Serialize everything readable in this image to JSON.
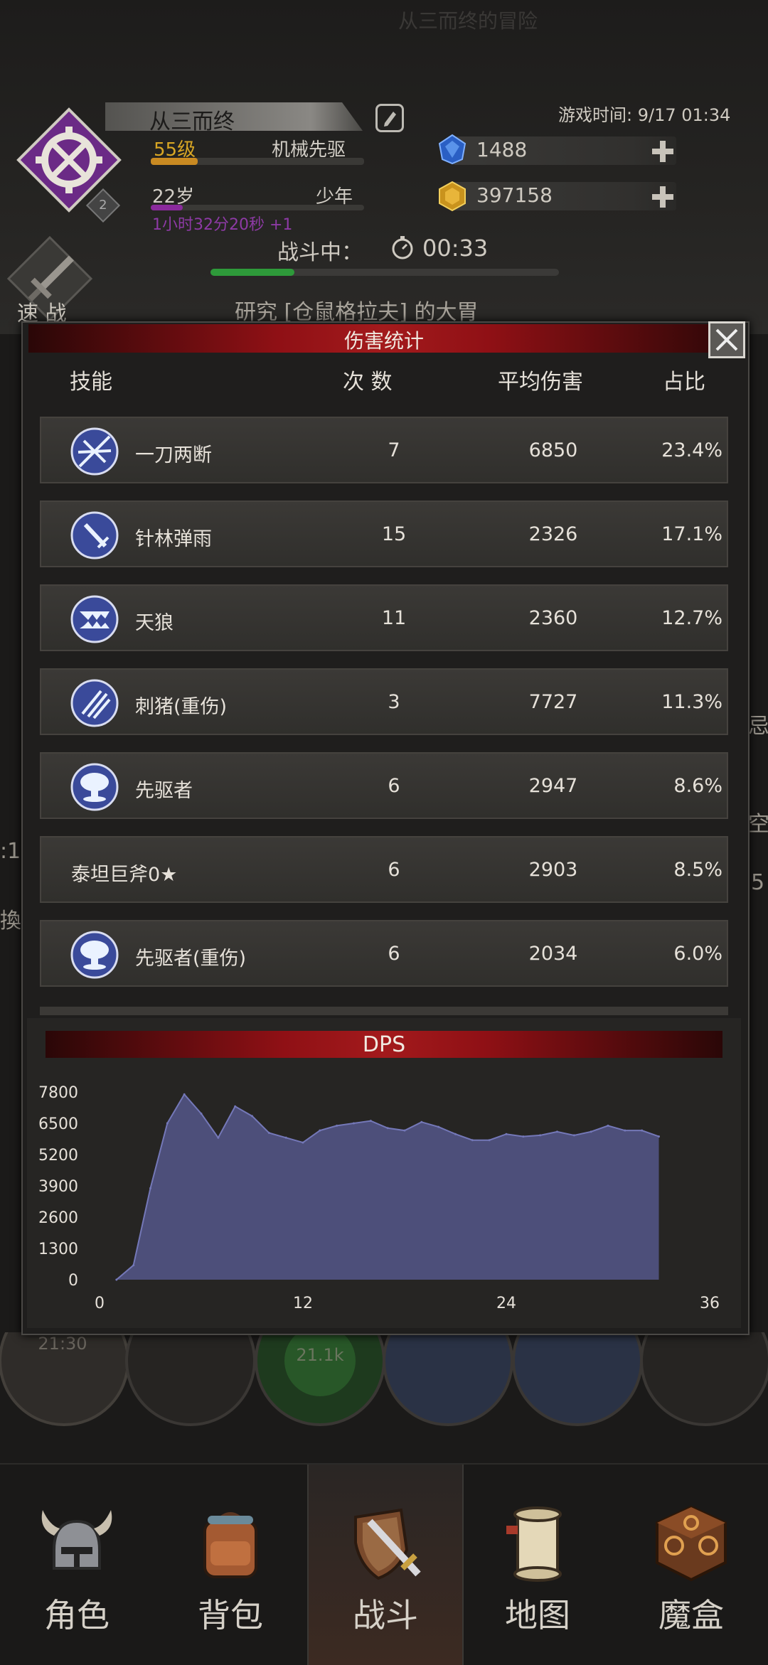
{
  "header": {
    "faded_top": "从三而终的冒险",
    "player_name": "从三而终",
    "level_badge": "2",
    "level_text": "55级",
    "class_text": "机械先驱",
    "level_progress": 0.22,
    "age_text": "22岁",
    "stage_text": "少年",
    "age_progress": 0.15,
    "age_timer": "1小时32分20秒 +1",
    "game_time": "游戏时间: 9/17 01:34",
    "gems": "1488",
    "gold": "397158",
    "battle_label": "战斗中：",
    "battle_time": "00:33",
    "battle_progress": 0.24,
    "quick_label": "速 战",
    "research_text": "研究 [仓鼠格拉夫] 的大胃"
  },
  "background_fragments": {
    "right_a": "忌",
    "right_b": "空",
    "right_c": "5",
    "left_a": ":1",
    "left_b": "換"
  },
  "panel": {
    "title": "伤害统计",
    "columns": {
      "skill": "技能",
      "count": "次 数",
      "avg": "平均伤害",
      "ratio": "占比"
    },
    "rows": [
      {
        "name": "一刀两断",
        "count": "7",
        "avg": "6850",
        "ratio": "23.4%",
        "icon": "slash-burst-icon"
      },
      {
        "name": "针林弹雨",
        "count": "15",
        "avg": "2326",
        "ratio": "17.1%",
        "icon": "sword-icon"
      },
      {
        "name": "天狼",
        "count": "11",
        "avg": "2360",
        "ratio": "12.7%",
        "icon": "fangs-icon"
      },
      {
        "name": "刺猪(重伤)",
        "count": "3",
        "avg": "7727",
        "ratio": "11.3%",
        "icon": "claw-scratch-icon"
      },
      {
        "name": "先驱者",
        "count": "6",
        "avg": "2947",
        "ratio": "8.6%",
        "icon": "mushroom-cloud-icon"
      },
      {
        "name": "泰坦巨斧0★",
        "count": "6",
        "avg": "2903",
        "ratio": "8.5%",
        "icon": ""
      },
      {
        "name": "先驱者(重伤)",
        "count": "6",
        "avg": "2034",
        "ratio": "6.0%",
        "icon": "mushroom-cloud-icon"
      }
    ]
  },
  "chart_data": {
    "type": "area",
    "title": "DPS",
    "xlabel": "",
    "ylabel": "",
    "x_ticks": [
      0,
      12,
      24,
      36
    ],
    "y_ticks": [
      0,
      1300,
      2600,
      3900,
      5200,
      6500,
      7800
    ],
    "xlim": [
      0,
      36
    ],
    "ylim": [
      0,
      7800
    ],
    "x": [
      1,
      2,
      3,
      4,
      5,
      6,
      7,
      8,
      9,
      10,
      11,
      12,
      13,
      14,
      15,
      16,
      17,
      18,
      19,
      20,
      21,
      22,
      23,
      24,
      25,
      26,
      27,
      28,
      29,
      30,
      31,
      32,
      33
    ],
    "values": [
      0,
      600,
      3800,
      6500,
      7700,
      6900,
      5900,
      7200,
      6800,
      6100,
      5900,
      5700,
      6200,
      6400,
      6500,
      6600,
      6300,
      6200,
      6550,
      6350,
      6050,
      5800,
      5800,
      6050,
      5950,
      6000,
      6150,
      6000,
      6150,
      6400,
      6200,
      6200,
      5950
    ],
    "fill_color": "#4d4f7a",
    "line_color": "#7478b8",
    "grid": false
  },
  "nav": {
    "items": [
      {
        "label": "角色",
        "icon": "horned-helmet-icon"
      },
      {
        "label": "背包",
        "icon": "backpack-icon"
      },
      {
        "label": "战斗",
        "icon": "sword-shield-icon",
        "active": true
      },
      {
        "label": "地图",
        "icon": "scroll-map-icon"
      },
      {
        "label": "魔盒",
        "icon": "magic-box-icon"
      }
    ]
  },
  "orbs": {
    "left_value": "21:30",
    "mid_value": "21.1k"
  },
  "colors": {
    "accent_red": "#a31a1c",
    "gold": "#d8a624",
    "purple": "#8a2a9c",
    "green": "#2e9a3a"
  }
}
